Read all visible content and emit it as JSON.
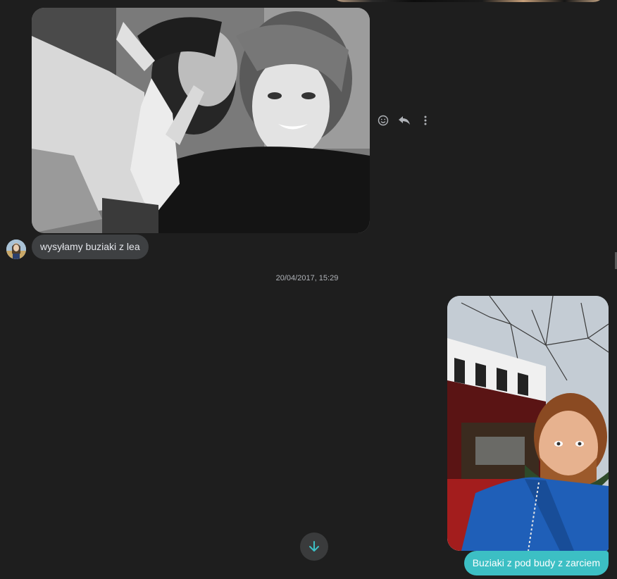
{
  "conversation": {
    "incoming_message": {
      "text": "wysyłamy buziaki z lea"
    },
    "timestamp": "20/04/2017, 15:29",
    "outgoing_message": {
      "text": "Buziaki z pod budy z zarciem"
    }
  },
  "message_actions": {
    "icons": [
      "smiley-icon",
      "reply-icon",
      "more-options-icon"
    ]
  },
  "scroll_down_button": {
    "icon": "arrow-down-icon"
  },
  "colors": {
    "background": "#1e1e1e",
    "incoming_bubble": "#3e4042",
    "outgoing_bubble": "#3cbfc4",
    "scroll_arrow": "#3cbfc4",
    "muted_text": "#b0b3b8"
  }
}
